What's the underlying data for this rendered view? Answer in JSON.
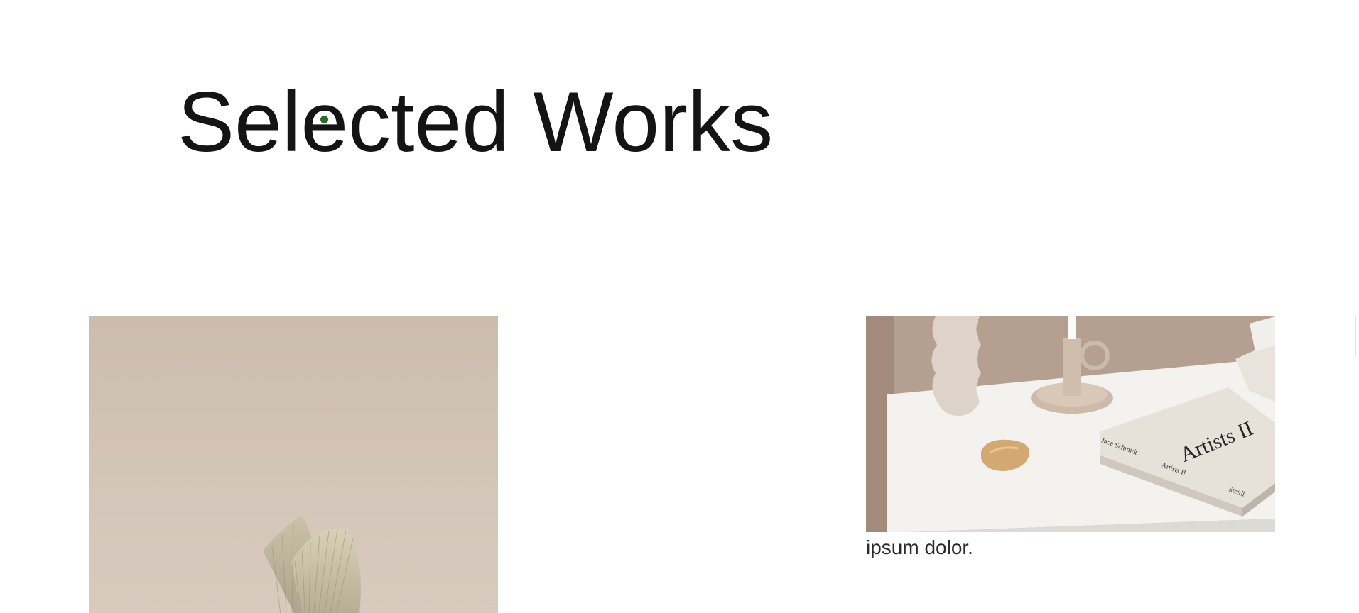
{
  "section": {
    "heading": "Selected Works"
  },
  "works": [
    {
      "image": "minimal-palm-fan-decor-photo",
      "caption": ""
    },
    {
      "image": "desk-with-book-and-candle-holder-photo",
      "caption": "ipsum dolor.",
      "book_title": "Artists II",
      "book_spine": [
        "Jace Schmidt",
        "Artists II",
        "Steidl"
      ]
    }
  ],
  "colors": {
    "heading": "#141414",
    "cursor": "#2d6a2a",
    "wall_left": "#d3c3b6",
    "wall_right": "#b49d8e",
    "table": "#f2f1ee"
  }
}
